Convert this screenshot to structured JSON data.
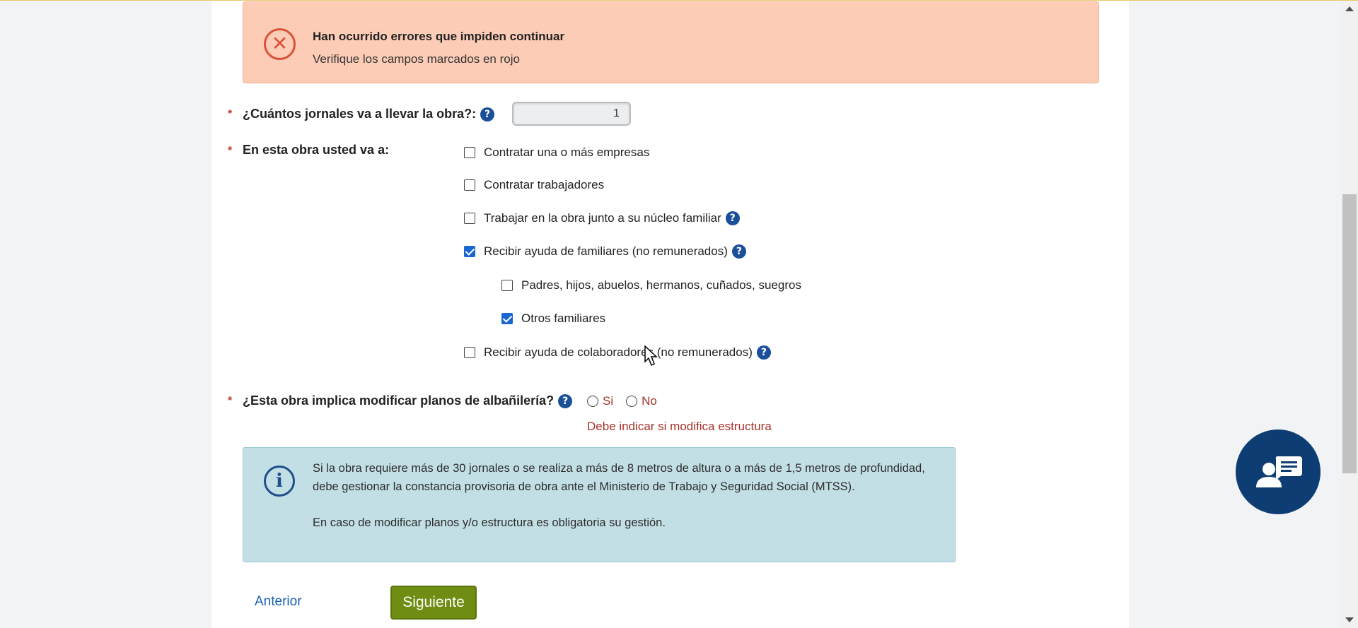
{
  "error_banner": {
    "icon": "x-circle-icon",
    "title": "Han ocurrido errores que impiden continuar",
    "message": "Verifique los campos marcados en rojo"
  },
  "required_mark": "*",
  "help_glyph": "?",
  "jornales": {
    "label": "¿Cuántos jornales va a llevar la obra?:",
    "value": "1"
  },
  "obra_opciones": {
    "label": "En esta obra usted va a:",
    "items": [
      {
        "label": "Contratar una o más empresas",
        "checked": false
      },
      {
        "label": "Contratar trabajadores",
        "checked": false
      },
      {
        "label": "Trabajar en la obra junto a su núcleo familiar",
        "checked": false
      },
      {
        "label": "Recibir ayuda de familiares (no remunerados)",
        "checked": true
      },
      {
        "label": "Padres, hijos, abuelos, hermanos, cuñados, suegros",
        "checked": false
      },
      {
        "label": "Otros familiares",
        "checked": true
      },
      {
        "label": "Recibir ayuda de colaboradores (no remunerados)",
        "checked": false
      }
    ]
  },
  "planos": {
    "label": "¿Esta obra implica modificar planos de albañilería?",
    "options": [
      "Si",
      "No"
    ],
    "error": "Debe indicar si modifica estructura"
  },
  "info": {
    "icon": "info-icon",
    "paragraph1": "Si la obra requiere más de 30 jornales o se realiza a más de 8 metros de altura o a más de 1,5 metros de profundidad, debe gestionar la constancia provisoria de obra ante el Ministerio de Trabajo y Seguridad Social (MTSS).",
    "paragraph2": "En caso de modificar planos y/o estructura es obligatoria su gestión."
  },
  "nav": {
    "prev_label": "Anterior",
    "next_label": "Siguiente"
  },
  "colors": {
    "error_bg": "#fcccb6",
    "info_bg": "#c3dfe6",
    "next_button": "#6f8d12",
    "chat_button": "#0e3d74",
    "error_text": "#a8322a"
  }
}
